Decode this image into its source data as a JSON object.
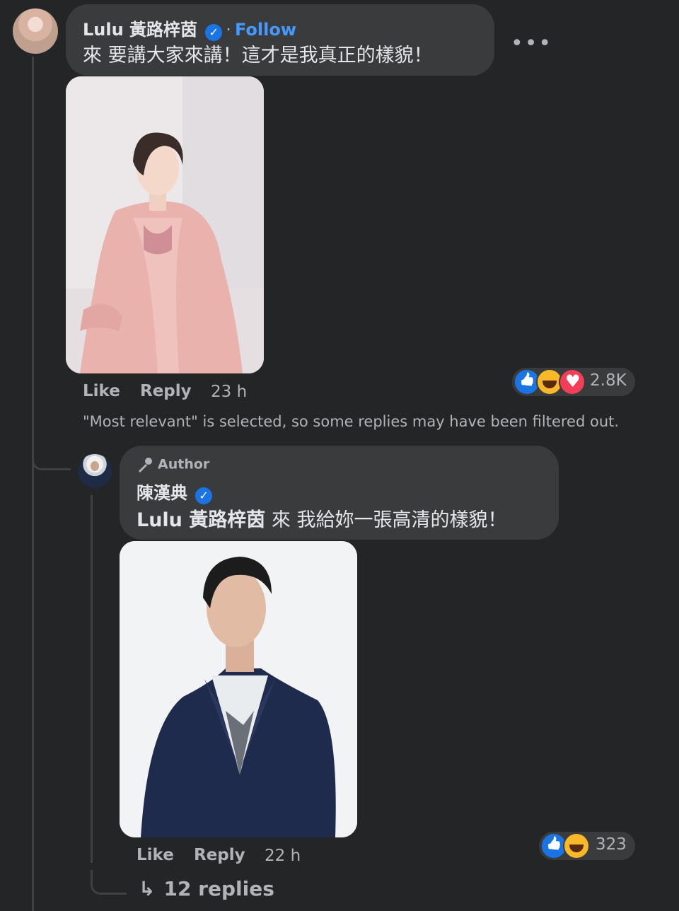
{
  "comment": {
    "author": "Lulu 黃路梓茵",
    "follow_label": "Follow",
    "separator": "·",
    "text": "來 要講大家來講！這才是我真正的樣貌！",
    "actions": {
      "like": "Like",
      "reply": "Reply",
      "time": "23 h"
    },
    "reactions": {
      "types": [
        "like",
        "haha",
        "love"
      ],
      "count": "2.8K"
    },
    "more_icon": "more-horizontal-icon"
  },
  "filter_notice": "\"Most relevant\" is selected, so some replies may have been filtered out.",
  "reply": {
    "badge": "Author",
    "author": "陳漢典",
    "mention": "Lulu 黃路梓茵",
    "text": " 來 我給妳一張高清的樣貌！",
    "actions": {
      "like": "Like",
      "reply": "Reply",
      "time": "22 h"
    },
    "reactions": {
      "types": [
        "like",
        "haha"
      ],
      "count": "323"
    }
  },
  "view_replies": {
    "arrow": "↳",
    "label": "12 replies"
  },
  "colors": {
    "background": "#242526",
    "bubble": "#3a3b3c",
    "link": "#4599ff",
    "verified": "#1b74e4",
    "muted": "#b0b3b8"
  }
}
